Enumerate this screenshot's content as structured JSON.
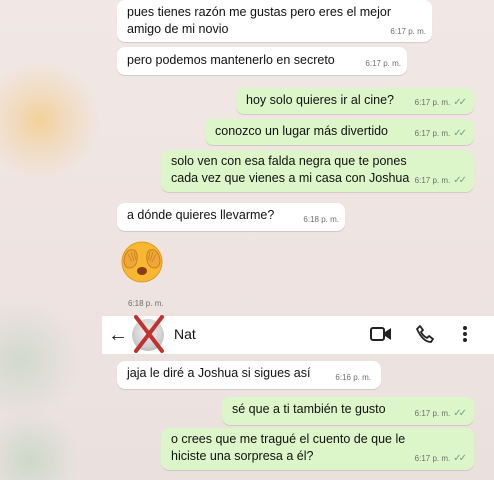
{
  "messages": [
    {
      "text": "pues tienes razón me gustas pero eres el mejor amigo de mi novio",
      "time": "6:17 p. m.",
      "dir": "in"
    },
    {
      "text": "pero podemos mantenerlo en secreto",
      "time": "6:17 p. m.",
      "dir": "in"
    },
    {
      "text": "hoy solo quieres ir al cine?",
      "time": "6:17 p. m.",
      "dir": "out"
    },
    {
      "text": "conozco un lugar más divertido",
      "time": "6:17 p. m.",
      "dir": "out"
    },
    {
      "text": "solo ven con esa falda negra que te pones cada vez que vienes a mi casa con Joshua",
      "time": "6:17 p. m.",
      "dir": "out"
    },
    {
      "text": "a dónde quieres llevarme?",
      "time": "6:18 p. m.",
      "dir": "in"
    },
    {
      "text": "",
      "time": "6:18 p. m.",
      "dir": "in",
      "emoji": "face-hiding-eyes-emoji"
    },
    {
      "text": "jaja le diré a Joshua si sigues así",
      "time": "6:16 p. m.",
      "dir": "in"
    },
    {
      "text": "sé que a ti también te gusto",
      "time": "6:17 p. m.",
      "dir": "out"
    },
    {
      "text": "o crees que me tragué el cuento de que le hiciste una sorpresa a él?",
      "time": "6:17 p. m.",
      "dir": "out"
    }
  ],
  "header": {
    "contact_name": "Nat",
    "icons": [
      "back-arrow-icon",
      "avatar",
      "video-call-icon",
      "phone-icon",
      "more-vertical-icon"
    ]
  },
  "colors": {
    "incoming": "#ffffff",
    "outgoing": "#dcf6c9",
    "read_ticks": "#6aa383",
    "avatar_cross": "#c0322e"
  }
}
